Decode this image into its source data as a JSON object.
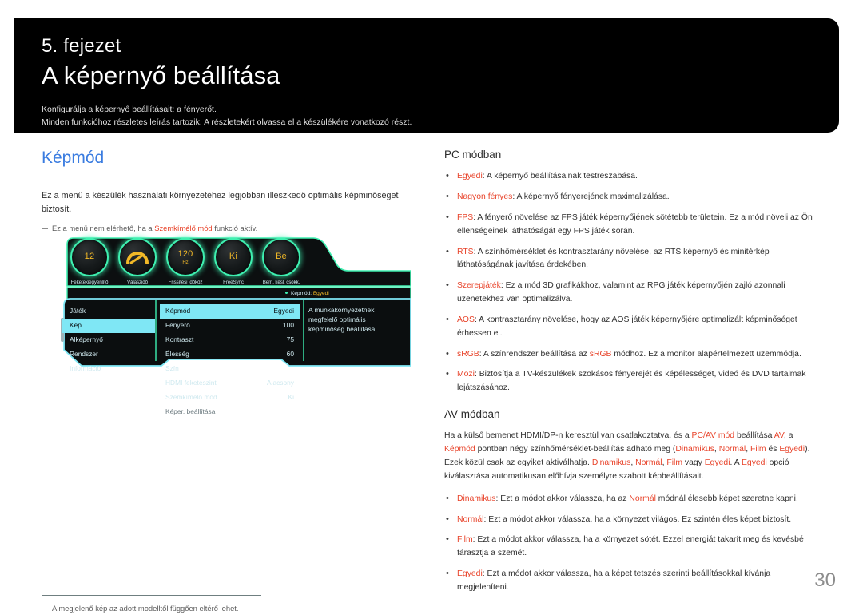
{
  "header": {
    "chapter_number": "5. fejezet",
    "chapter_title": "A képernyő beállítása",
    "desc_line1": "Konfigurálja a képernyő beállításait: a fényerőt.",
    "desc_line2": "Minden funkcióhoz részletes leírás tartozik. A részletekért olvassa el a készülékére vonatkozó részt."
  },
  "left": {
    "section_heading": "Képmód",
    "intro": "Ez a menü a készülék használati környezetéhez legjobban illeszkedő optimális képminőséget biztosít.",
    "note_pre": "Ez a menü nem elérhető, ha a ",
    "note_accent": "Szemkímélő mód",
    "note_post": " funkció aktív.",
    "bottom_note": "A megjelenő kép az adott modelltől függően eltérő lehet."
  },
  "osd": {
    "dials": [
      {
        "value": "12",
        "unit": "",
        "label": "Feketekiegyenlítő"
      },
      {
        "value": "",
        "unit": "",
        "label": "Válaszidő"
      },
      {
        "value": "120",
        "unit": "Hz",
        "label": "Frissítési időköz"
      },
      {
        "value": "Ki",
        "unit": "",
        "label": "FreeSync"
      },
      {
        "value": "Be",
        "unit": "",
        "label": "Bem. késl. csökk."
      }
    ],
    "mode_tag_label": "Képmód:",
    "mode_tag_value": "Egyedi",
    "nav": [
      {
        "label": "Játék",
        "selected": false
      },
      {
        "label": "Kép",
        "selected": true
      },
      {
        "label": "Alképernyő",
        "selected": false
      },
      {
        "label": "Rendszer",
        "selected": false
      },
      {
        "label": "Információ",
        "selected": false
      }
    ],
    "rows": [
      {
        "label": "Képmód",
        "value": "Egyedi",
        "selected": true,
        "dim": false
      },
      {
        "label": "Fényerő",
        "value": "100",
        "selected": false,
        "dim": false
      },
      {
        "label": "Kontraszt",
        "value": "75",
        "selected": false,
        "dim": false
      },
      {
        "label": "Élesség",
        "value": "60",
        "selected": false,
        "dim": false
      },
      {
        "label": "Szín",
        "value": "",
        "selected": false,
        "dim": false
      },
      {
        "label": "HDMI feketeszint",
        "value": "Alacsony",
        "selected": false,
        "dim": false
      },
      {
        "label": "Szemkímélő mód",
        "value": "Ki",
        "selected": false,
        "dim": false
      },
      {
        "label": "Képer. beállítása",
        "value": "",
        "selected": false,
        "dim": true
      }
    ],
    "description": "A munkakörnyezetnek megfelelő optimális képminőség beállítása."
  },
  "right": {
    "pc_heading": "PC módban",
    "pc_items": [
      {
        "term": "Egyedi",
        "text": ": A képernyő beállításainak testreszabása."
      },
      {
        "term": "Nagyon fényes",
        "text": ": A képernyő fényerejének maximalizálása."
      },
      {
        "term": "FPS",
        "text": ": A fényerő növelése az FPS játék képernyőjének sötétebb területein. Ez a mód növeli az Ön ellenségeinek láthatóságát egy FPS játék során."
      },
      {
        "term": "RTS",
        "text": ": A színhőmérséklet és kontrasztarány növelése, az RTS képernyő és minitérkép láthatóságának javítása érdekében."
      },
      {
        "term": "Szerepjáték",
        "text": ": Ez a mód 3D grafikákhoz, valamint az RPG játék képernyőjén zajló azonnali üzenetekhez van optimalizálva."
      },
      {
        "term": "AOS",
        "text": ": A kontrasztarány növelése, hogy az AOS játék képernyőjére optimalizált képminőséget érhessen el."
      },
      {
        "term": "sRGB",
        "text": ": A színrendszer beállítása az ",
        "term2": "sRGB",
        "text2": " módhoz. Ez a monitor alapértelmezett üzemmódja."
      },
      {
        "term": "Mozi",
        "text": ": Biztosítja a TV-készülékek szokásos fényerejét és képélességét, videó és DVD tartalmak lejátszásához."
      }
    ],
    "av_heading": "AV módban",
    "av_intro_1": "Ha a külső bemenet HDMI/DP-n keresztül van csatlakoztatva, és a ",
    "av_a1": "PC/AV mód",
    "av_intro_2": " beállítása ",
    "av_a2": "AV",
    "av_intro_3": ", a ",
    "av_a3": "Képmód",
    "av_intro_4": " pontban négy színhőmérséklet-beállítás adható meg (",
    "av_a4": "Dinamikus",
    "av_intro_5": ", ",
    "av_a5": "Normál",
    "av_intro_6": ", ",
    "av_a6": "Film",
    "av_intro_7": " és ",
    "av_a7": "Egyedi",
    "av_intro_8": "). Ezek közül csak az egyiket aktiválhatja. ",
    "av_a8": "Dinamikus",
    "av_intro_9": ", ",
    "av_a9": "Normál",
    "av_intro_10": ", ",
    "av_a10": "Film",
    "av_intro_11": " vagy ",
    "av_a11": "Egyedi",
    "av_intro_12": ". A ",
    "av_a12": "Egyedi",
    "av_intro_13": " opció kiválasztása automatikusan előhívja személyre szabott képbeállításait.",
    "av_items": [
      {
        "term": "Dinamikus",
        "text": ": Ezt a módot akkor válassza, ha az ",
        "term2": "Normál",
        "text2": " módnál élesebb képet szeretne kapni."
      },
      {
        "term": "Normál",
        "text": ": Ezt a módot akkor válassza, ha a környezet világos. Ez szintén éles képet biztosít."
      },
      {
        "term": "Film",
        "text": ": Ezt a módot akkor válassza, ha a környezet sötét. Ezzel energiát takarít meg és kevésbé fárasztja a szemét."
      },
      {
        "term": "Egyedi",
        "text": ": Ezt a módot akkor válassza, ha a képet tetszés szerinti beállításokkal kívánja megjeleníteni."
      }
    ]
  },
  "footer": {
    "page_number": "30"
  },
  "colors": {
    "accent": "#e8432a",
    "heading": "#3a7ce0",
    "osd_green": "#3ef0b0",
    "osd_cyan": "#7fe7f5",
    "osd_amber": "#f2b927"
  }
}
